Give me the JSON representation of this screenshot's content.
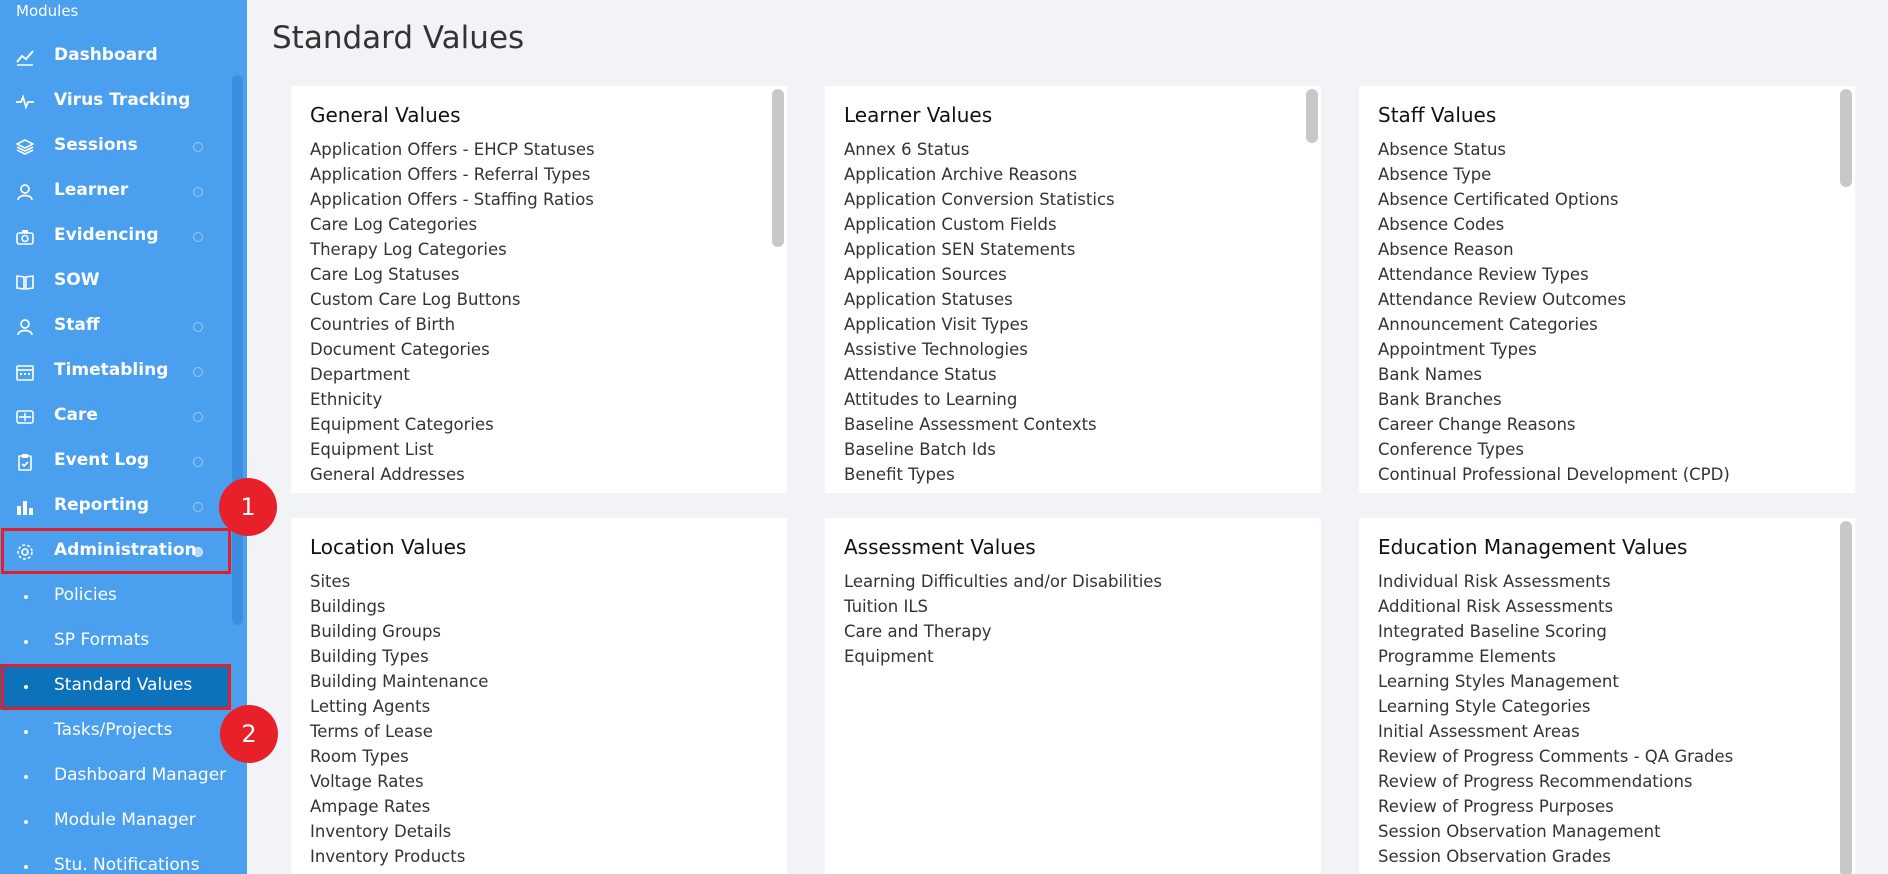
{
  "sidebar": {
    "header": "Modules",
    "items": [
      {
        "label": "Dashboard",
        "icon": "chart-line-icon",
        "dot": false
      },
      {
        "label": "Virus Tracking",
        "icon": "pulse-icon",
        "dot": false
      },
      {
        "label": "Sessions",
        "icon": "layers-icon",
        "dot": true
      },
      {
        "label": "Learner",
        "icon": "user-icon",
        "dot": true
      },
      {
        "label": "Evidencing",
        "icon": "camera-icon",
        "dot": true
      },
      {
        "label": "SOW",
        "icon": "book-icon",
        "dot": false
      },
      {
        "label": "Staff",
        "icon": "staff-icon",
        "dot": true
      },
      {
        "label": "Timetabling",
        "icon": "calendar-icon",
        "dot": true
      },
      {
        "label": "Care",
        "icon": "care-icon",
        "dot": true
      },
      {
        "label": "Event Log",
        "icon": "clipboard-icon",
        "dot": true
      },
      {
        "label": "Reporting",
        "icon": "bar-chart-icon",
        "dot": true
      },
      {
        "label": "Administration",
        "icon": "gear-icon",
        "dot": true
      }
    ],
    "subitems": [
      {
        "label": "Policies"
      },
      {
        "label": "SP Formats"
      },
      {
        "label": "Standard Values"
      },
      {
        "label": "Tasks/Projects"
      },
      {
        "label": "Dashboard Manager"
      },
      {
        "label": "Module Manager"
      },
      {
        "label": "Stu. Notifications"
      }
    ],
    "active_subitem": "Standard Values"
  },
  "annotations": {
    "badge1": "1",
    "badge2": "2"
  },
  "page": {
    "title": "Standard Values"
  },
  "cards": [
    {
      "title": "General Values",
      "items": [
        "Application Offers - EHCP Statuses",
        "Application Offers - Referral Types",
        "Application Offers - Staffing Ratios",
        "Care Log Categories",
        "Therapy Log Categories",
        "Care Log Statuses",
        "Custom Care Log Buttons",
        "Countries of Birth",
        "Document Categories",
        "Department",
        "Ethnicity",
        "Equipment Categories",
        "Equipment List",
        "General Addresses"
      ]
    },
    {
      "title": "Learner Values",
      "items": [
        "Annex 6 Status",
        "Application Archive Reasons",
        "Application Conversion Statistics",
        "Application Custom Fields",
        "Application SEN Statements",
        "Application Sources",
        "Application Statuses",
        "Application Visit Types",
        "Assistive Technologies",
        "Attendance Status",
        "Attitudes to Learning",
        "Baseline Assessment Contexts",
        "Baseline Batch Ids",
        "Benefit Types"
      ]
    },
    {
      "title": "Staff Values",
      "items": [
        "Absence Status",
        "Absence Type",
        "Absence Certificated Options",
        "Absence Codes",
        "Absence Reason",
        "Attendance Review Types",
        "Attendance Review Outcomes",
        "Announcement Categories",
        "Appointment Types",
        "Bank Names",
        "Bank Branches",
        "Career Change Reasons",
        "Conference Types",
        "Continual Professional Development (CPD)"
      ]
    },
    {
      "title": "Location Values",
      "items": [
        "Sites",
        "Buildings",
        "Building Groups",
        "Building Types",
        "Building Maintenance",
        "Letting Agents",
        "Terms of Lease",
        "Room Types",
        "Voltage Rates",
        "Ampage Rates",
        "Inventory Details",
        "Inventory Products"
      ]
    },
    {
      "title": "Assessment Values",
      "items": [
        "Learning Difficulties and/or Disabilities",
        "Tuition ILS",
        "Care and Therapy",
        "Equipment"
      ]
    },
    {
      "title": "Education Management Values",
      "items": [
        "Individual Risk Assessments",
        "Additional Risk Assessments",
        "Integrated Baseline Scoring",
        "Programme Elements",
        "Learning Styles Management",
        "Learning Style Categories",
        "Initial Assessment Areas",
        "Review of Progress Comments - QA Grades",
        "Review of Progress Recommendations",
        "Review of Progress Purposes",
        "Session Observation Management",
        "Session Observation Grades"
      ]
    }
  ],
  "colors": {
    "sidebar": "#4a9fee",
    "active": "#0b72bb",
    "highlight": "#e0202a"
  }
}
